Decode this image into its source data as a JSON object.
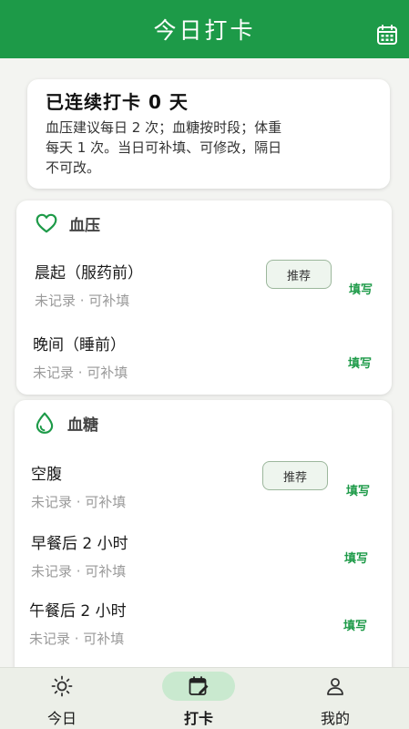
{
  "header": {
    "title": "今日打卡",
    "calendar_icon": "calendar-icon"
  },
  "summary": {
    "title": "已连续打卡 0 天",
    "desc_lines": [
      "血压建议每日 2 次；血糖按时段；体重",
      "每天 1 次。当日可补填、可修改，隔日",
      "不可改。"
    ]
  },
  "sections": {
    "blood_pressure": {
      "title": "血压",
      "icon": "heart-outline-icon",
      "rows": [
        {
          "label": "晨起（服药前）",
          "status": "未记录 · 可补填",
          "recommend": "推荐",
          "action": "填写"
        },
        {
          "label": "晚间（睡前）",
          "status": "未记录 · 可补填",
          "action": "填写"
        }
      ]
    },
    "blood_glucose": {
      "title": "血糖",
      "icon": "water-drop-icon",
      "rows": [
        {
          "label": "空腹",
          "status": "未记录 · 可补填",
          "recommend": "推荐",
          "action": "填写"
        },
        {
          "label": "早餐后 2 小时",
          "status": "未记录 · 可补填",
          "action": "填写"
        },
        {
          "label": "午餐后 2 小时",
          "status": "未记录 · 可补填",
          "action": "填写"
        }
      ]
    }
  },
  "nav": {
    "items": [
      {
        "label": "今日",
        "icon": "sun-icon",
        "active": false
      },
      {
        "label": "打卡",
        "icon": "calendar-edit-icon",
        "active": true
      },
      {
        "label": "我的",
        "icon": "person-icon",
        "active": false
      }
    ]
  },
  "colors": {
    "primary": "#1d9a48",
    "active_pill": "#c9e9cf",
    "background": "#f3f4f1"
  }
}
